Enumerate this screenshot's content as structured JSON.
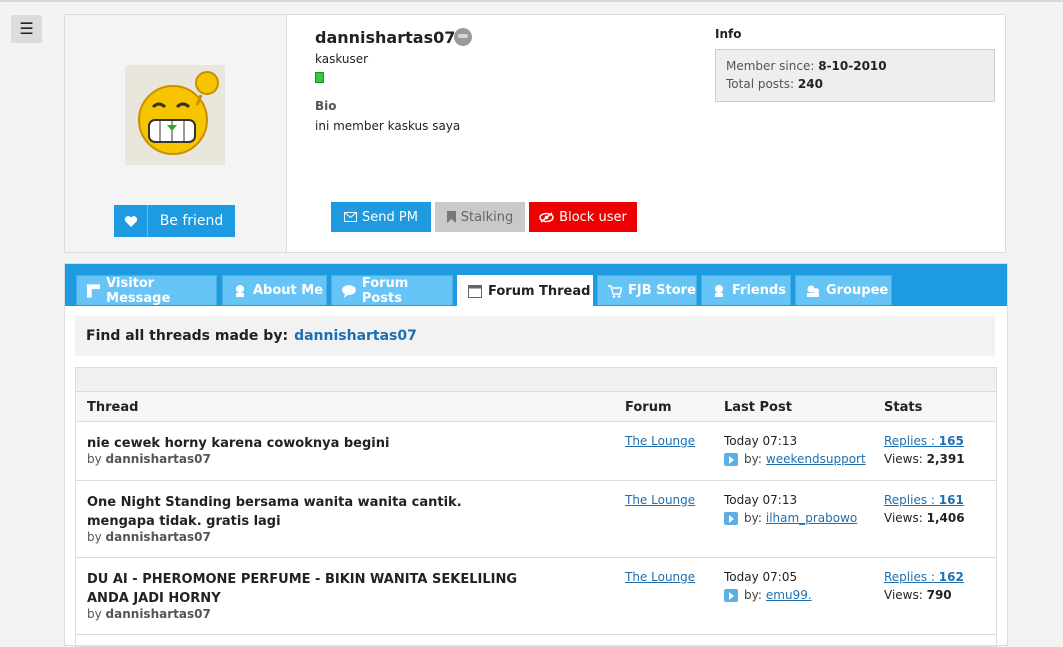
{
  "menu_icon": "hamburger-icon",
  "profile": {
    "username": "dannishartas07",
    "rank": "kaskuser",
    "bio_heading": "Bio",
    "bio_text": "ini member kaskus saya",
    "befriend_label": "Be friend",
    "send_pm_label": "Send PM",
    "stalking_label": "Stalking",
    "block_label": "Block user",
    "info_heading": "Info",
    "member_since_label": "Member since:",
    "member_since_value": "8-10-2010",
    "total_posts_label": "Total posts:",
    "total_posts_value": "240"
  },
  "tabs": [
    {
      "label": "Visitor Message",
      "icon": "message-icon"
    },
    {
      "label": "About Me",
      "icon": "user-icon"
    },
    {
      "label": "Forum Posts",
      "icon": "chat-icon"
    },
    {
      "label": "Forum Thread",
      "icon": "calendar-icon",
      "active": true
    },
    {
      "label": "FJB Store",
      "icon": "cart-icon"
    },
    {
      "label": "Friends",
      "icon": "friends-icon"
    },
    {
      "label": "Groupee",
      "icon": "group-icon"
    }
  ],
  "find": {
    "label": "Find all threads made by:",
    "user": "dannishartas07"
  },
  "table": {
    "headers": {
      "thread": "Thread",
      "forum": "Forum",
      "last_post": "Last Post",
      "stats": "Stats"
    },
    "rows": [
      {
        "title": "nie cewek horny karena cowoknya begini",
        "by_prefix": "by",
        "author": "dannishartas07",
        "forum": "The Lounge",
        "last_post_time": "Today 07:13",
        "last_post_by_prefix": "by:",
        "last_post_user": "weekendsupport",
        "replies_label": "Replies :",
        "replies": "165",
        "views_label": "Views:",
        "views": "2,391"
      },
      {
        "title": "One Night Standing bersama wanita wanita cantik. mengapa tidak. gratis lagi",
        "by_prefix": "by",
        "author": "dannishartas07",
        "forum": "The Lounge",
        "last_post_time": "Today 07:13",
        "last_post_by_prefix": "by:",
        "last_post_user": "ilham_prabowo",
        "replies_label": "Replies :",
        "replies": "161",
        "views_label": "Views:",
        "views": "1,406"
      },
      {
        "title": "DU AI - PHEROMONE PERFUME - BIKIN WANITA SEKELILING ANDA JADI HORNY",
        "by_prefix": "by",
        "author": "dannishartas07",
        "forum": "The Lounge",
        "last_post_time": "Today 07:05",
        "last_post_by_prefix": "by:",
        "last_post_user": "emu99.",
        "replies_label": "Replies :",
        "replies": "162",
        "views_label": "Views:",
        "views": "790"
      }
    ]
  },
  "colors": {
    "accent": "#1e9ae0",
    "block": "#ee0000",
    "link": "#1e6fb0"
  }
}
